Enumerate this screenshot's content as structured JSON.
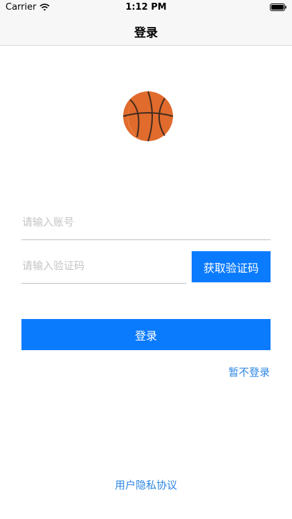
{
  "status_bar": {
    "carrier": "Carrier",
    "time": "1:12 PM"
  },
  "nav": {
    "title": "登录"
  },
  "logo": {
    "icon": "basketball-icon",
    "color": "#e06b2c"
  },
  "form": {
    "account_placeholder": "请输入账号",
    "account_value": "",
    "code_placeholder": "请输入验证码",
    "code_value": "",
    "get_code_label": "获取验证码",
    "login_label": "登录",
    "skip_label": "暂不登录"
  },
  "footer": {
    "privacy_label": "用户隐私协议"
  },
  "colors": {
    "accent": "#0b7bfe",
    "link": "#2d86e5",
    "bar_background": "#f7f7f7"
  }
}
